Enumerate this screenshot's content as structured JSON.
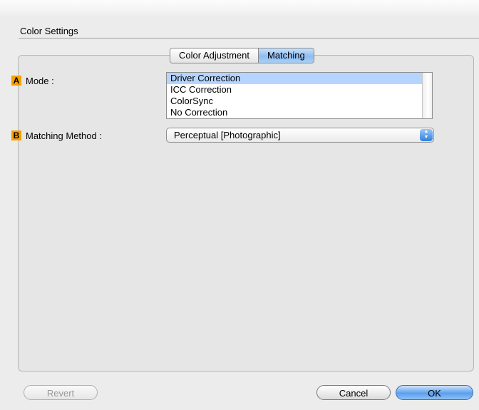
{
  "header": {
    "title": "Color Settings"
  },
  "tabs": [
    {
      "label": "Color Adjustment",
      "active": false
    },
    {
      "label": "Matching",
      "active": true
    }
  ],
  "mode": {
    "badge": "A",
    "label": "Mode :",
    "options": [
      "Driver Correction",
      "ICC Correction",
      "ColorSync",
      "No Correction"
    ],
    "selected": "Driver Correction"
  },
  "matching_method": {
    "badge": "B",
    "label": "Matching Method :",
    "value": "Perceptual [Photographic]"
  },
  "buttons": {
    "revert": "Revert",
    "cancel": "Cancel",
    "ok": "OK"
  },
  "colors": {
    "badge": "#f5a000",
    "selection": "#b5d5ff",
    "default_button": "#5aa0ee"
  }
}
